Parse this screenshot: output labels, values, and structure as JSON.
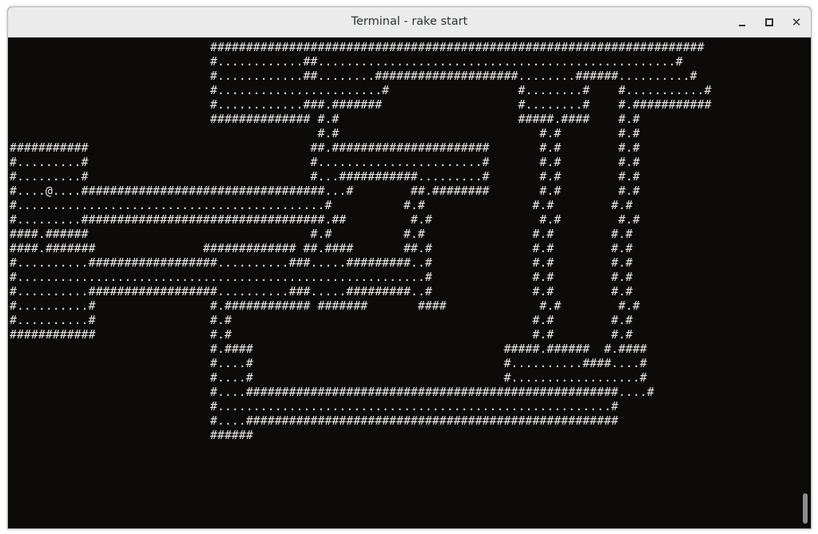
{
  "window": {
    "title": "Terminal - rake start",
    "controls": {
      "minimize": "minimize",
      "maximize": "maximize",
      "close": "✕"
    }
  },
  "terminal": {
    "screen_text": "                            #####################################################################\n                            #............##..................................................#\n                            #............##........####################........######..........#\n                            #.......................#                  #........#    #...........#\n                            #............###.#######                   #........#    #.###########\n                            ############## #.#                         #####.####    #.#\n                                           #.#                            #.#        #.#\n###########                               ##.######################       #.#        #.#\n#.........#                               #.......................#       #.#        #.#\n#.........#                               #...###########.........#       #.#        #.#\n#....@....##################################...#        ##.########       #.#        #.#\n#...........................................#          #.#               #.#        #.#\n#.........##################################.##         #.#               #.#        #.#\n####.######                               #.#          #.#               #.#        #.#\n####.#######               ############# ##.####       ##.#              #.#        #.#\n#..........##################..........###.....#########..#              #.#        #.#\n#.........................................................#              #.#        #.#\n#..........##################..........###.....#########..#              #.#        #.#\n#..........#                #.############ #######       ####             #.#        #.#\n#..........#                #.#                                          #.#        #.#\n############                #.#                                          #.#        #.#\n                            #.####                                   #####.######  #.####\n                            #....#                                   #..........####....#\n                            #....#                                   #..................#\n                            #....####################################################....#\n                            #.......................................................#\n                            #....####################################################\n                            ######"
  }
}
